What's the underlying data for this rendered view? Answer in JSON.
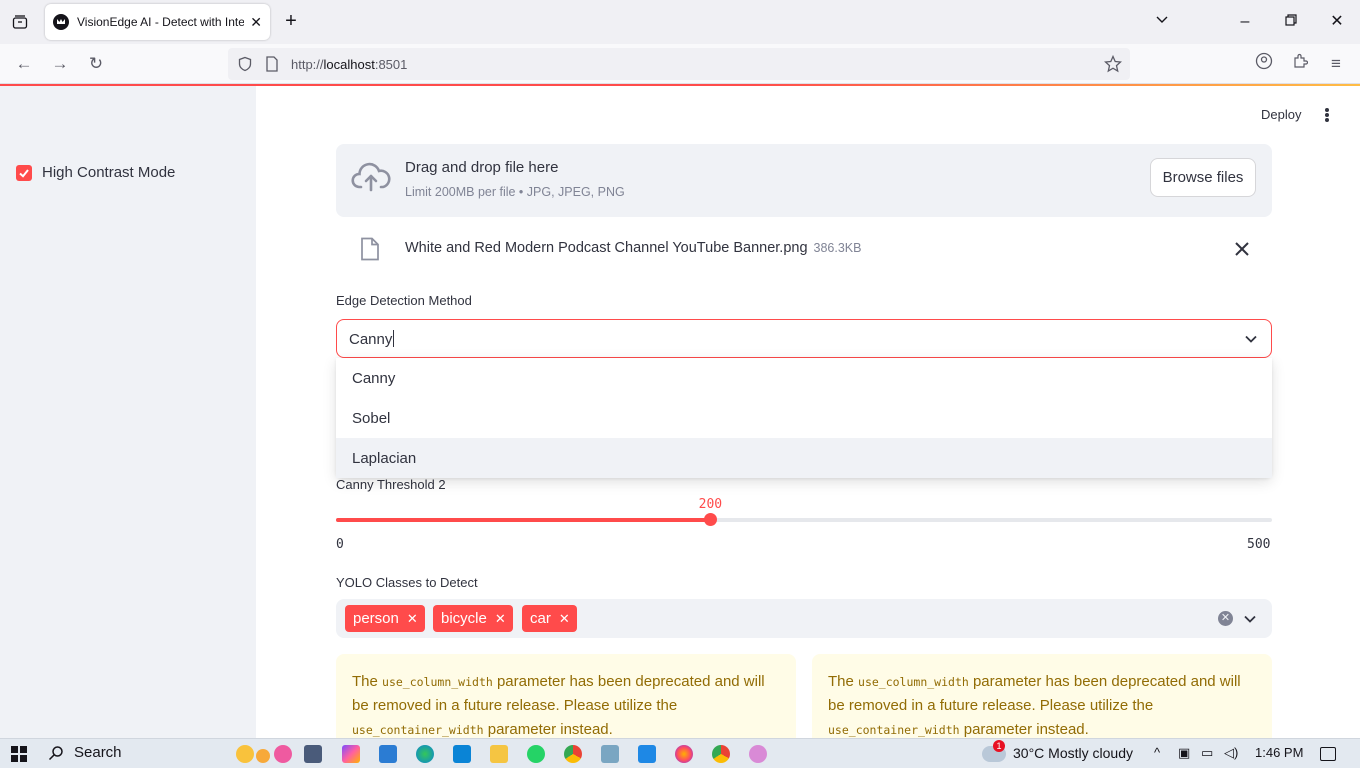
{
  "browser": {
    "tab_title": "VisionEdge AI - Detect with Intelligence",
    "url_prefix": "http://",
    "url_host": "localhost",
    "url_port": ":8501"
  },
  "sidebar": {
    "high_contrast_label": "High Contrast Mode",
    "high_contrast_checked": true
  },
  "header": {
    "deploy_label": "Deploy"
  },
  "uploader": {
    "title": "Drag and drop file here",
    "subtitle": "Limit 200MB per file • JPG, JPEG, PNG",
    "browse_label": "Browse files",
    "file_name": "White and Red Modern Podcast Channel YouTube Banner.png",
    "file_size": "386.3KB"
  },
  "edge_method": {
    "label": "Edge Detection Method",
    "value": "Canny",
    "options": [
      "Canny",
      "Sobel",
      "Laplacian"
    ],
    "hovered_option": "Laplacian"
  },
  "threshold2": {
    "label": "Canny Threshold 2",
    "value": "200",
    "min": "0",
    "max": "500",
    "fraction": 0.4
  },
  "yolo": {
    "label": "YOLO Classes to Detect",
    "chips": [
      "person",
      "bicycle",
      "car"
    ]
  },
  "alerts": [
    {
      "pre": "The ",
      "code1": "use_column_width",
      "mid": " parameter has been deprecated and will be removed in a future release. Please utilize the ",
      "code2": "use_container_width",
      "post": " parameter instead."
    },
    {
      "pre": "The ",
      "code1": "use_column_width",
      "mid": " parameter has been deprecated and will be removed in a future release. Please utilize the ",
      "code2": "use_container_width",
      "post": " parameter instead."
    }
  ],
  "taskbar": {
    "search_label": "Search",
    "weather_temp": "30°C",
    "weather_desc": "Mostly cloudy",
    "time": "1:46 PM",
    "notification_count": "1"
  },
  "colors": {
    "accent": "#ff4b4b",
    "sidebar_bg": "#f0f2f6",
    "warning_bg": "#fffce7",
    "warning_text": "#926c05"
  }
}
